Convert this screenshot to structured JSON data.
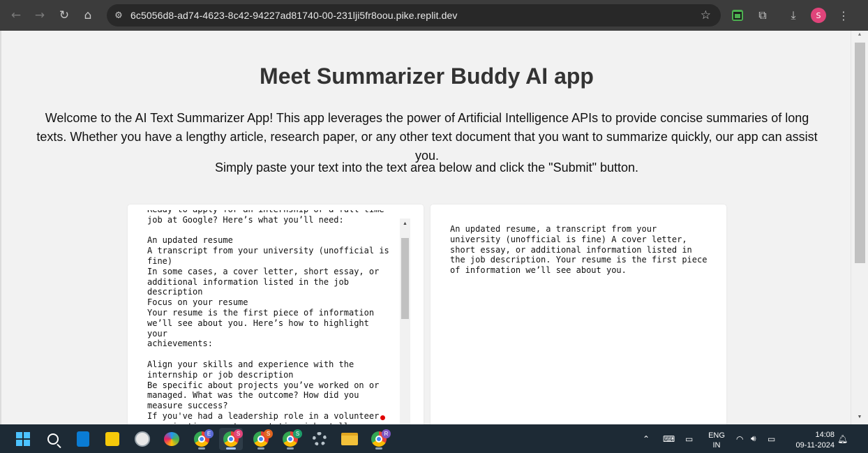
{
  "browser": {
    "url": "6c5056d8-ad74-4623-8c42-94227ad81740-00-231lji5fr8oou.pike.replit.dev",
    "profile_initial": "S",
    "icons": [
      "back-icon",
      "forward-icon",
      "reload-icon",
      "home-icon",
      "site-info-icon",
      "bookmark-star-icon",
      "extension-icon",
      "puzzle-icon",
      "download-icon",
      "menu-dots-icon"
    ]
  },
  "page": {
    "title": "Meet Summarizer Buddy AI app",
    "intro": "Welcome to the AI Text Summarizer App! This app leverages the power of Artificial Intelligence APIs to provide concise summaries of long texts. Whether you have a lengthy article, research paper, or any other text document that you want to summarize quickly, our app can assist you.",
    "instruction": "Simply paste your text into the text area below and click the \"Submit\" button.",
    "input_text": "Ready to apply for an internship or a full-time\njob at Google? Here’s what you’ll need:\n\nAn updated resume\nA transcript from your university (unofficial is\nfine)\nIn some cases, a cover letter, short essay, or\nadditional information listed in the job\ndescription\nFocus on your resume\nYour resume is the first piece of information\nwe’ll see about you. Here’s how to highlight your\nachievements:\n\nAlign your skills and experience with the\ninternship or job description\nBe specific about projects you’ve worked on or\nmanaged. What was the outcome? How did you\nmeasure success?\nIf you've had a leadership role in a volunteer\norganization or at a part-time job, tell us about",
    "summary_text": "An updated resume, a transcript from your\nuniversity (unofficial is fine) A cover letter,\nshort essay, or additional information listed in\nthe job description. Your resume is the first piece\nof information we’ll see about you."
  },
  "taskbar": {
    "apps": [
      {
        "name": "start-button"
      },
      {
        "name": "search-button"
      },
      {
        "name": "phone-link-app"
      },
      {
        "name": "sticky-notes-app"
      },
      {
        "name": "clock-app"
      },
      {
        "name": "paint-app"
      },
      {
        "name": "chrome-profile-e",
        "badge": "E",
        "badge_color": "#5b6bd6"
      },
      {
        "name": "chrome-profile-s-active",
        "badge": "S",
        "badge_color": "#e0447a"
      },
      {
        "name": "chrome-profile-s2",
        "badge": "S",
        "badge_color": "#e0641f"
      },
      {
        "name": "chrome-profile-s3",
        "badge": "S",
        "badge_color": "#1e9e6a"
      },
      {
        "name": "settings-app"
      },
      {
        "name": "file-explorer-app"
      },
      {
        "name": "chrome-profile-r",
        "badge": "R",
        "badge_color": "#7e57c2"
      }
    ],
    "lang_line1": "ENG",
    "lang_line2": "IN",
    "time": "14:08",
    "date": "09-11-2024"
  }
}
